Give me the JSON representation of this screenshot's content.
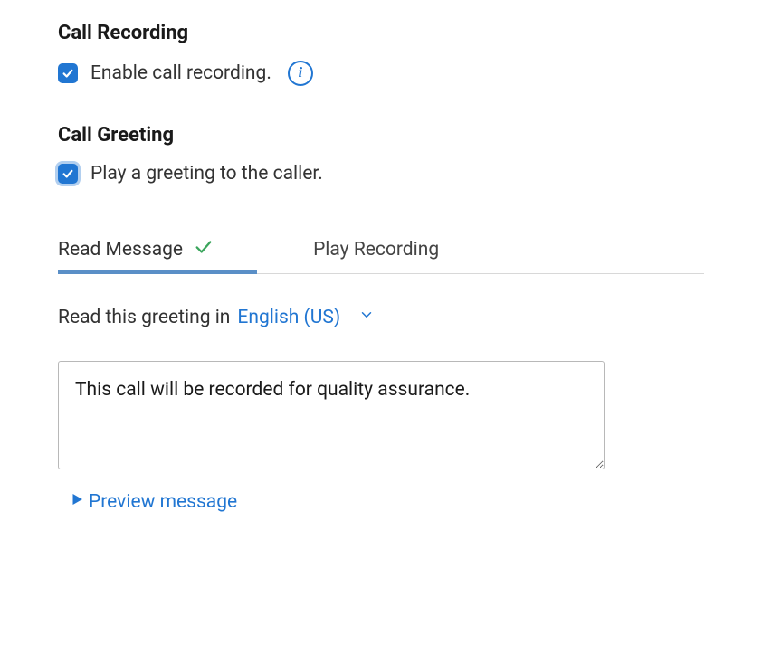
{
  "callRecording": {
    "title": "Call Recording",
    "enableLabel": "Enable call recording.",
    "enabled": true
  },
  "callGreeting": {
    "title": "Call Greeting",
    "playLabel": "Play a greeting to the caller.",
    "enabled": true,
    "tabs": {
      "readMessage": "Read Message",
      "playRecording": "Play Recording"
    },
    "languagePrefix": "Read this greeting in",
    "languageSelected": "English (US)",
    "messageText": "This call will be recorded for quality assurance.",
    "previewLabel": "Preview message"
  }
}
